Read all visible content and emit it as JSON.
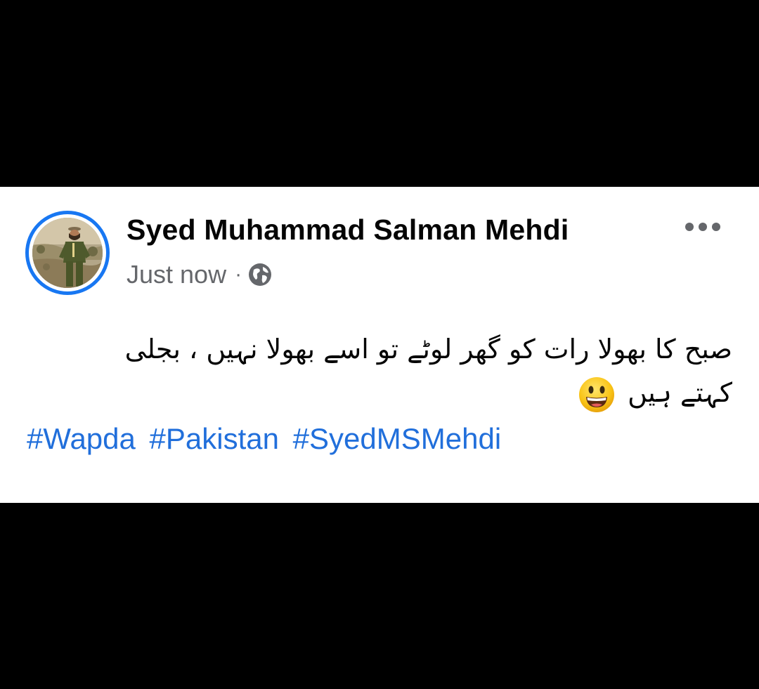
{
  "post": {
    "author": "Syed Muhammad Salman Mehdi",
    "timestamp": "Just now",
    "separator": "·",
    "privacy_icon": "globe-icon",
    "more_icon": "more-options-icon",
    "text_line1": "صبح کا بھولا رات کو گھر لوٹے تو اسے بھولا نہیں ، بجلی",
    "text_line2": "کہتے ہیں",
    "emoji": "grinning-face",
    "hashtags": [
      "#Wapda",
      "#Pakistan",
      "#SyedMSMehdi"
    ]
  },
  "colors": {
    "background": "#000000",
    "card": "#ffffff",
    "avatar_ring": "#1877f2",
    "hashtag": "#216fdb",
    "meta_text": "#65676b"
  }
}
